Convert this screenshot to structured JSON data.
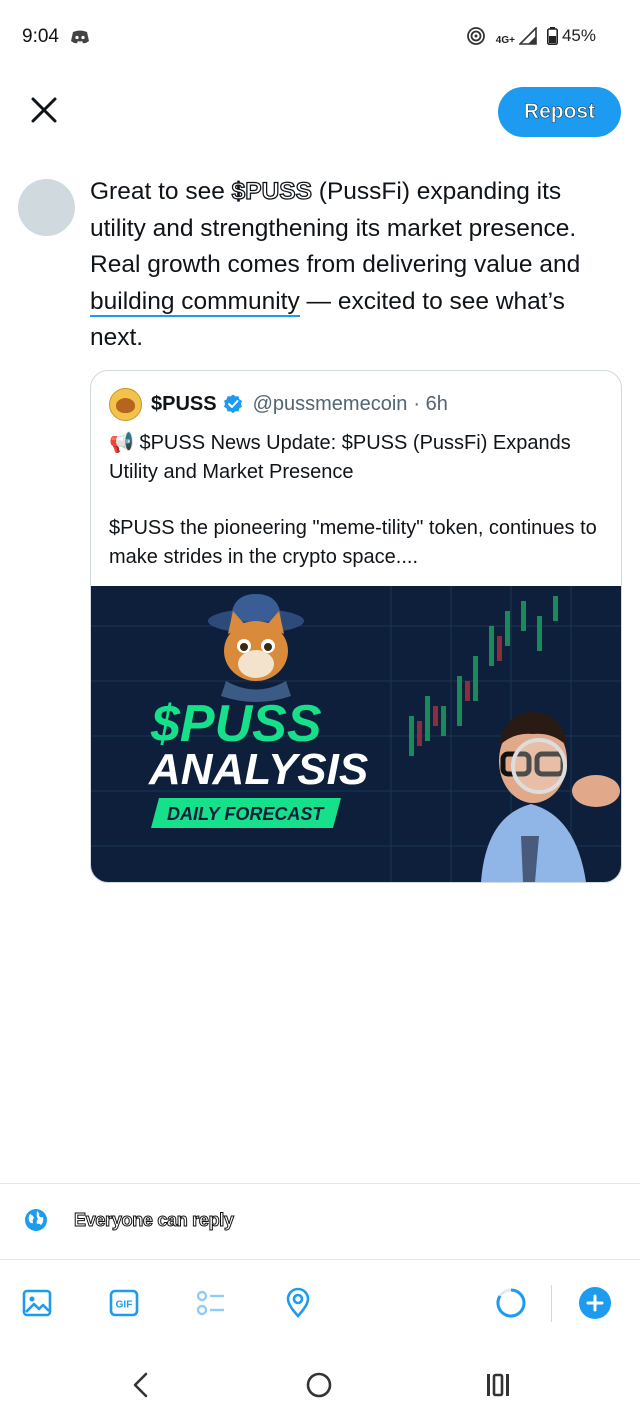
{
  "status_bar": {
    "time": "9:04",
    "network": "4G+",
    "battery": "45%"
  },
  "top_bar": {
    "repost_label": "Repost"
  },
  "post": {
    "text_before": "Great to see ",
    "cashtag": "$PUSS",
    "text_middle": " (PussFi) expanding its utility and strengthening its market presence. Real growth comes from delivering value and ",
    "link_text": "building community",
    "text_after": " — excited to see what’s next."
  },
  "quote": {
    "name": "$PUSS",
    "handle": "@pussmemecoin",
    "time": "· 6h",
    "line1": "📢 $PUSS News Update: $PUSS (PussFi) Expands Utility and Market Presence",
    "line2": "$PUSS the pioneering \"meme-tility\" token, continues to make strides in the crypto space....",
    "image": {
      "title": "$PUSS",
      "subtitle": "ANALYSIS",
      "badge": "DAILY FORECAST"
    }
  },
  "footer": {
    "reply_setting": "Everyone can reply"
  },
  "colors": {
    "accent": "#1d9bf0",
    "image_bg": "#0d1f3a",
    "image_green": "#16e08a"
  }
}
